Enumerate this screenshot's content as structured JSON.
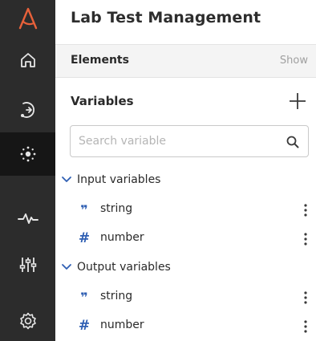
{
  "app": {
    "logo_color": "#e8613a"
  },
  "rail": {
    "items": [
      {
        "name": "home",
        "icon": "home-icon",
        "active": false
      },
      {
        "name": "flows",
        "icon": "flow-icon",
        "active": false
      },
      {
        "name": "elements",
        "icon": "network-icon",
        "active": true
      },
      {
        "name": "monitoring",
        "icon": "pulse-icon",
        "active": false
      },
      {
        "name": "configuration",
        "icon": "sliders-icon",
        "active": false
      },
      {
        "name": "settings",
        "icon": "gear-icon",
        "active": false
      }
    ]
  },
  "panel": {
    "title": "Lab Test Management",
    "elements": {
      "label": "Elements",
      "show_label": "Show"
    },
    "variables": {
      "label": "Variables",
      "add_icon": "plus-icon"
    },
    "search": {
      "placeholder": "Search variable",
      "value": "",
      "icon": "search-icon"
    },
    "groups": [
      {
        "label": "Input variables",
        "expanded": true,
        "items": [
          {
            "type_icon": "quote-icon",
            "type_glyph": "❞",
            "name": "string"
          },
          {
            "type_icon": "hash-icon",
            "type_glyph": "#",
            "name": "number"
          }
        ]
      },
      {
        "label": "Output variables",
        "expanded": true,
        "items": [
          {
            "type_icon": "quote-icon",
            "type_glyph": "❞",
            "name": "string"
          },
          {
            "type_icon": "hash-icon",
            "type_glyph": "#",
            "name": "number"
          }
        ]
      }
    ]
  },
  "colors": {
    "rail_bg": "#2c2c2c",
    "rail_active": "#161616",
    "accent_blue": "#2f5fb3",
    "logo": "#e8613a"
  }
}
